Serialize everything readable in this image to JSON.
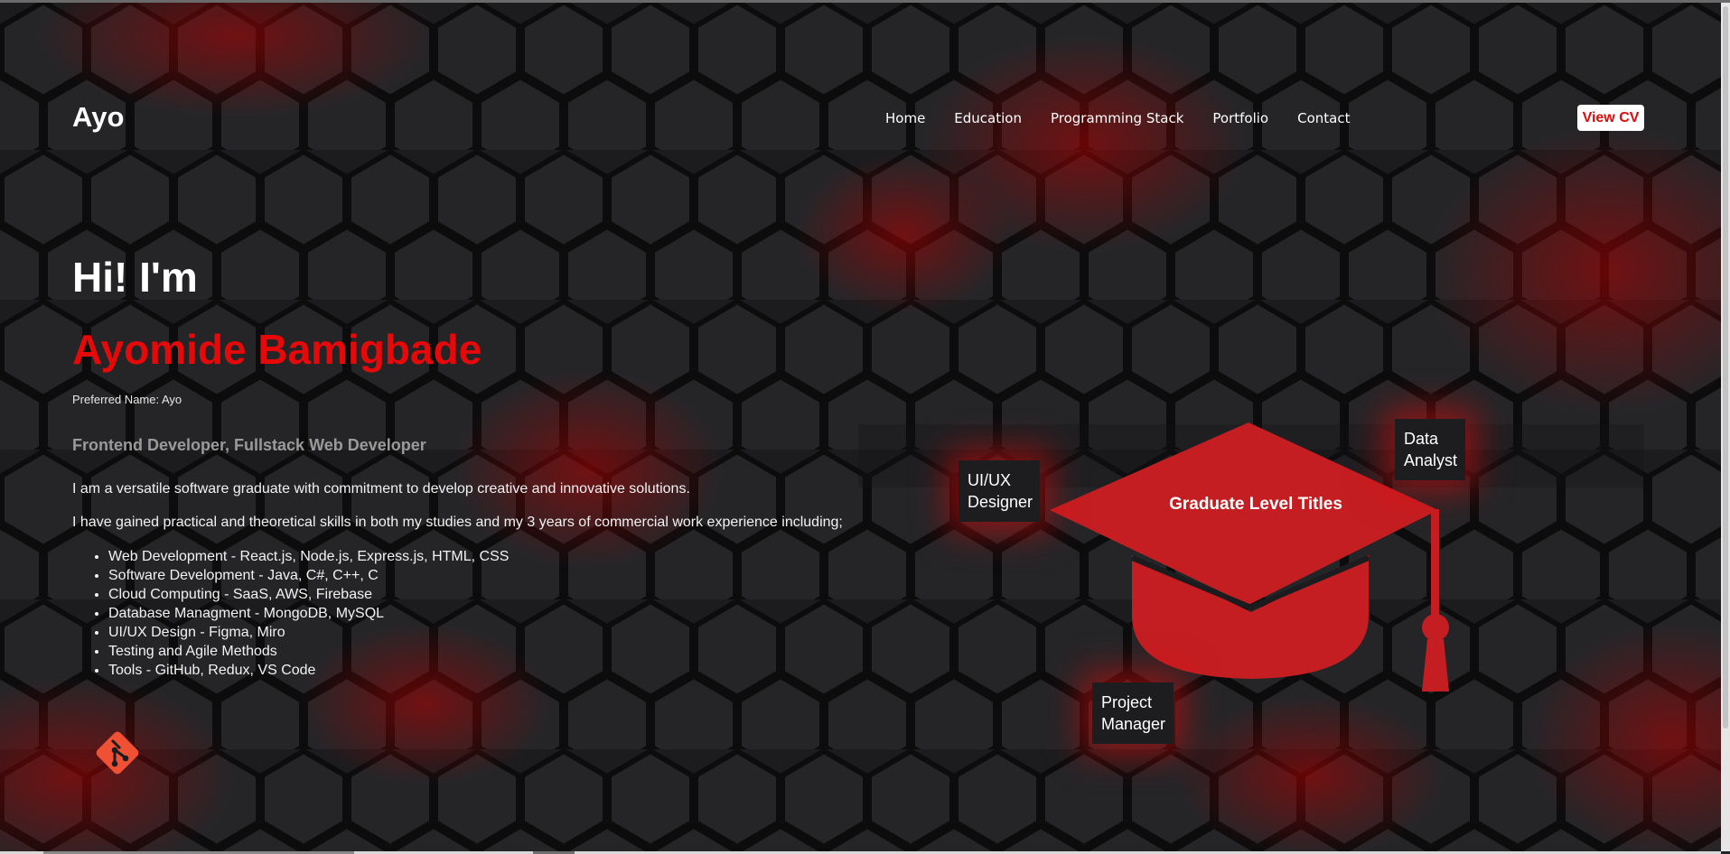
{
  "header": {
    "logo": "Ayo",
    "nav": [
      "Home",
      "Education",
      "Programming Stack",
      "Portfolio",
      "Contact"
    ],
    "cv_button": "View CV"
  },
  "hero": {
    "greeting": "Hi! I'm",
    "name": "Ayomide Bamigbade",
    "preferred_name": "Preferred Name: Ayo",
    "roles": "Frontend Developer, Fullstack Web Developer",
    "intro": "I am a versatile software graduate with commitment to develop creative and innovative solutions.",
    "experience": "I have gained practical and theoretical skills in both my studies and my 3 years of commercial work experience including;",
    "skills": [
      "Web Development - React.js, Node.js, Express.js, HTML, CSS",
      "Software Development - Java, C#, C++, C",
      "Cloud Computing - SaaS, AWS, Firebase",
      "Database Managment - MongoDB, MySQL",
      "UI/UX Design - Figma, Miro",
      "Testing and Agile Methods",
      "Tools - GitHub, Redux, VS Code"
    ]
  },
  "graduation": {
    "title": "Graduate Level Titles",
    "titles": [
      "UI/UX Designer",
      "Data Analyst",
      "Project Manager"
    ]
  },
  "icons": {
    "git": "git-icon",
    "cap": "graduation-cap-icon"
  },
  "colors": {
    "accent": "#e5090a",
    "background": "#1c1c1e",
    "cap": "#c41e22"
  }
}
